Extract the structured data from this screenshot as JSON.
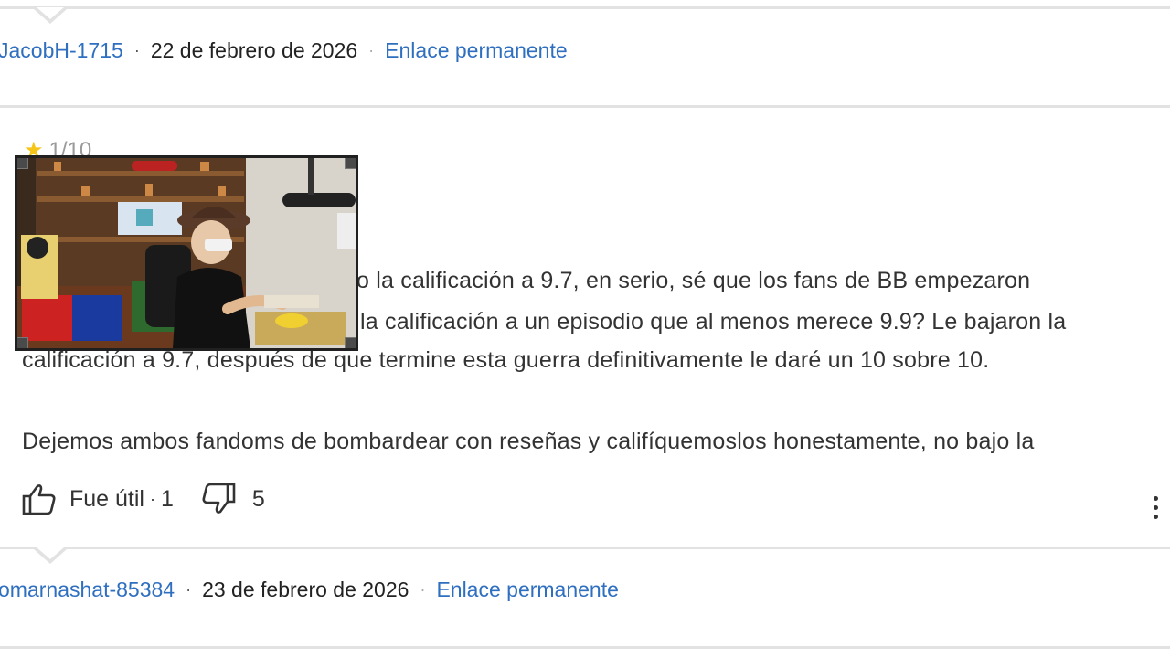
{
  "reviews": [
    {
      "username": "JacobH-1715",
      "separator": "·",
      "date": "22 de febrero de 2026",
      "permalink_label": "Enlace permanente"
    },
    {
      "username": "omarnashat-85384",
      "separator": "·",
      "date": "23 de febrero de 2026",
      "permalink_label": "Enlace permanente"
    }
  ],
  "current_review": {
    "rating_partial": "1/10",
    "body_lines": [
      "o la calificación a 9.7, en serio, sé que los fans de BB empezaron",
      "la calificación a un episodio que al menos merece 9.9? Le bajaron la",
      "calificación a 9.7, después de que termine esta guerra definitivamente le daré un 10 sobre 10.",
      "Dejemos ambos fandoms de bombardear con reseñas y califíquemoslos honestamente, no bajo la"
    ],
    "helpful_label": "Fue útil",
    "helpful_count": "1",
    "not_helpful_count": "5"
  },
  "icons": {
    "thumb_up": "thumbs-up-icon",
    "thumb_down": "thumbs-down-icon",
    "more": "more-vert-icon",
    "star": "star-icon"
  },
  "colors": {
    "link": "#2f6fc0",
    "star": "#f5c518",
    "divider": "#e2e2e2"
  }
}
